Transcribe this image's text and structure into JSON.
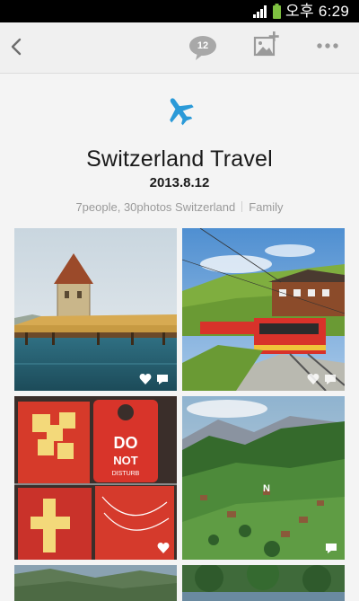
{
  "status_bar": {
    "time": "오후 6:29",
    "icons": [
      "signal-icon",
      "battery-icon"
    ]
  },
  "toolbar": {
    "back_icon": "chevron-left-icon",
    "comment_count": "12",
    "photo_add_icon": "photo-add-icon",
    "more_icon": "more-icon"
  },
  "album": {
    "icon": "airplane-icon",
    "icon_color": "#2b9ad8",
    "title": "Switzerland Travel",
    "date": "2013.8.12",
    "meta_info": "7people, 30photos Switzerland",
    "meta_category": "Family"
  },
  "photos": [
    {
      "subject": "chapel bridge with water tower on lake",
      "badges": [
        "heart-icon",
        "comment-icon"
      ]
    },
    {
      "subject": "red mountain train at station with green hills",
      "badges": [
        "heart-icon",
        "comment-icon"
      ]
    },
    {
      "subject": "red postcards and do not disturb door hanger",
      "door_hanger_text": "DO NOT DISTURB",
      "badges": [
        "heart-icon"
      ]
    },
    {
      "subject": "alpine valley with chalets and mountains",
      "badges": [
        "comment-icon"
      ]
    },
    {
      "subject": "mountain valley landscape",
      "badges": []
    },
    {
      "subject": "river and trees",
      "badges": []
    }
  ],
  "colors": {
    "status_bar_bg": "#000000",
    "toolbar_bg": "#f0f0f0",
    "page_bg": "#f4f4f4",
    "accent": "#2b9ad8"
  }
}
